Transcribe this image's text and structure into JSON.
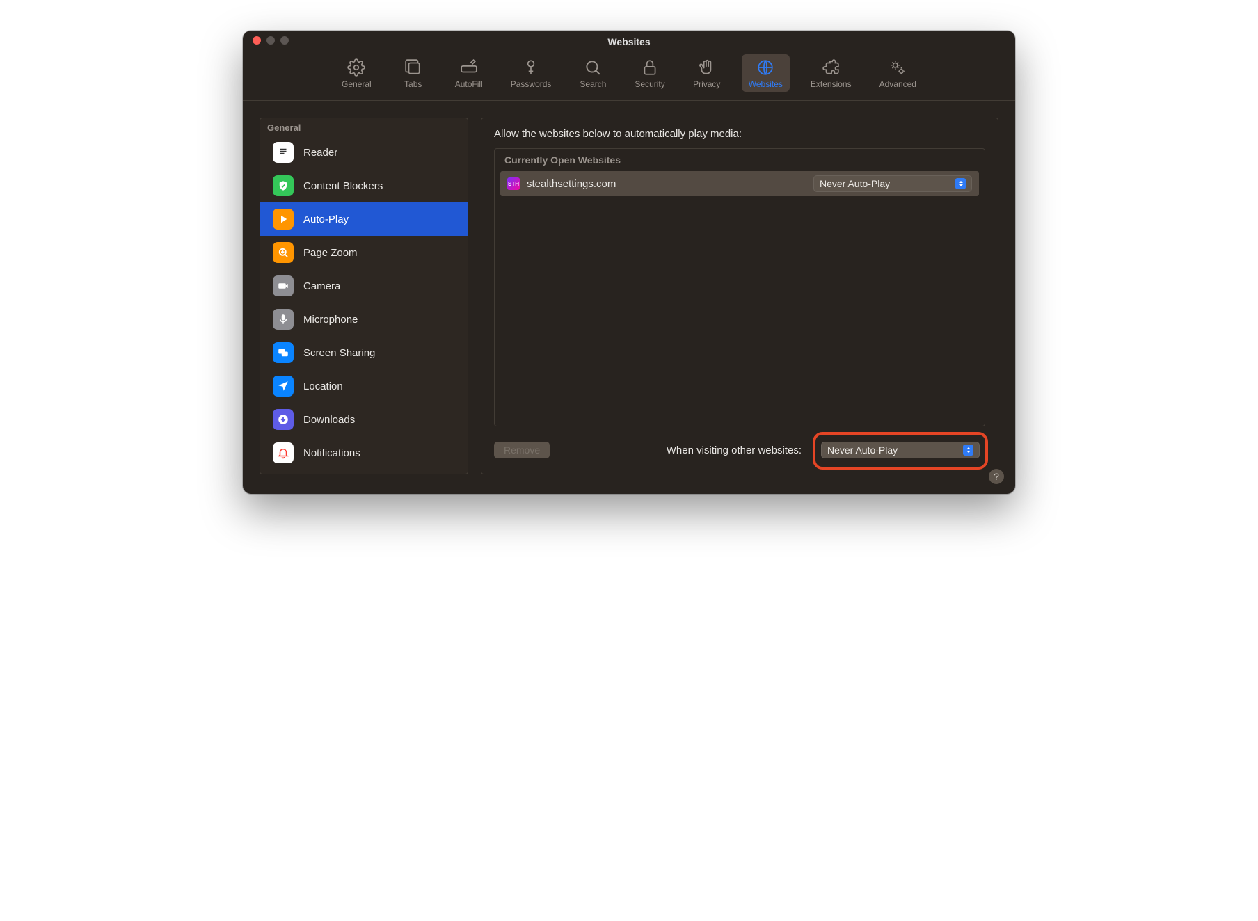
{
  "window": {
    "title": "Websites"
  },
  "toolbar": {
    "items": [
      {
        "label": "General"
      },
      {
        "label": "Tabs"
      },
      {
        "label": "AutoFill"
      },
      {
        "label": "Passwords"
      },
      {
        "label": "Search"
      },
      {
        "label": "Security"
      },
      {
        "label": "Privacy"
      },
      {
        "label": "Websites"
      },
      {
        "label": "Extensions"
      },
      {
        "label": "Advanced"
      }
    ],
    "active_index": 7
  },
  "sidebar": {
    "header": "General",
    "items": [
      {
        "label": "Reader"
      },
      {
        "label": "Content Blockers"
      },
      {
        "label": "Auto-Play"
      },
      {
        "label": "Page Zoom"
      },
      {
        "label": "Camera"
      },
      {
        "label": "Microphone"
      },
      {
        "label": "Screen Sharing"
      },
      {
        "label": "Location"
      },
      {
        "label": "Downloads"
      },
      {
        "label": "Notifications"
      }
    ],
    "selected_index": 2
  },
  "main": {
    "heading": "Allow the websites below to automatically play media:",
    "list_header": "Currently Open Websites",
    "sites": [
      {
        "domain": "stealthsettings.com",
        "favicon_text": "STH",
        "policy": "Never Auto-Play"
      }
    ],
    "remove_label": "Remove",
    "other_label": "When visiting other websites:",
    "other_policy": "Never Auto-Play"
  },
  "help_label": "?"
}
